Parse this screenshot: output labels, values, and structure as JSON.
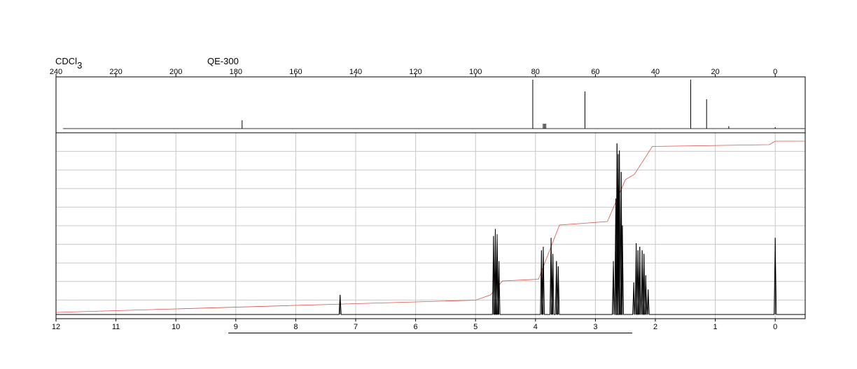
{
  "header": {
    "solvent_main": "CDCl",
    "solvent_sub": "3",
    "instrument": "QE-300"
  },
  "chart_data": [
    {
      "type": "line",
      "name": "13C NMR spectrum",
      "xlim": [
        240,
        -10
      ],
      "x_reversed": true,
      "ticks": [
        240,
        220,
        200,
        180,
        160,
        140,
        120,
        100,
        80,
        60,
        40,
        20,
        0
      ],
      "tick_labels": [
        "240",
        "220",
        "200",
        "180",
        "160",
        "140",
        "120",
        "100",
        "80",
        "60",
        "40",
        "20",
        "0"
      ],
      "grid": false,
      "peaks": [
        {
          "x": 177.9,
          "height": 0.17
        },
        {
          "x": 80.9,
          "height": 1.0
        },
        {
          "x": 77.4,
          "height": 0.1
        },
        {
          "x": 77.0,
          "height": 0.1
        },
        {
          "x": 76.6,
          "height": 0.1
        },
        {
          "x": 63.5,
          "height": 0.76
        },
        {
          "x": 28.2,
          "height": 1.0
        },
        {
          "x": 22.9,
          "height": 0.6
        },
        {
          "x": 15.5,
          "height": 0.05
        },
        {
          "x": 0.0,
          "height": 0.03
        }
      ]
    },
    {
      "type": "line",
      "name": "1H NMR spectrum",
      "xlim": [
        12,
        -0.5
      ],
      "x_reversed": true,
      "ticks": [
        12,
        11,
        10,
        9,
        8,
        7,
        6,
        5,
        4,
        3,
        2,
        1,
        0
      ],
      "tick_labels": [
        "12",
        "11",
        "10",
        "9",
        "8",
        "7",
        "6",
        "5",
        "4",
        "3",
        "2",
        "1",
        "0"
      ],
      "grid": true,
      "peaks": [
        {
          "x": 7.26,
          "height": 0.11
        },
        {
          "x": 4.7,
          "height": 0.44
        },
        {
          "x": 4.67,
          "height": 0.48
        },
        {
          "x": 4.64,
          "height": 0.45
        },
        {
          "x": 4.61,
          "height": 0.3
        },
        {
          "x": 3.9,
          "height": 0.36
        },
        {
          "x": 3.87,
          "height": 0.38
        },
        {
          "x": 3.74,
          "height": 0.43
        },
        {
          "x": 3.71,
          "height": 0.34
        },
        {
          "x": 3.65,
          "height": 0.3
        },
        {
          "x": 3.62,
          "height": 0.27
        },
        {
          "x": 2.7,
          "height": 0.3
        },
        {
          "x": 2.66,
          "height": 0.65
        },
        {
          "x": 2.64,
          "height": 0.96
        },
        {
          "x": 2.62,
          "height": 0.9
        },
        {
          "x": 2.6,
          "height": 0.92
        },
        {
          "x": 2.57,
          "height": 0.8
        },
        {
          "x": 2.55,
          "height": 0.5
        },
        {
          "x": 2.36,
          "height": 0.18
        },
        {
          "x": 2.32,
          "height": 0.4
        },
        {
          "x": 2.29,
          "height": 0.36
        },
        {
          "x": 2.26,
          "height": 0.38
        },
        {
          "x": 2.22,
          "height": 0.36
        },
        {
          "x": 2.19,
          "height": 0.34
        },
        {
          "x": 2.16,
          "height": 0.22
        },
        {
          "x": 2.12,
          "height": 0.14
        },
        {
          "x": 0.0,
          "height": 0.43
        }
      ],
      "integral": [
        {
          "x": 12.0,
          "y": 0.0
        },
        {
          "x": 5.0,
          "y": 0.07
        },
        {
          "x": 4.75,
          "y": 0.1
        },
        {
          "x": 4.55,
          "y": 0.18
        },
        {
          "x": 3.95,
          "y": 0.19
        },
        {
          "x": 3.6,
          "y": 0.5
        },
        {
          "x": 2.8,
          "y": 0.52
        },
        {
          "x": 2.5,
          "y": 0.76
        },
        {
          "x": 2.35,
          "y": 0.79
        },
        {
          "x": 2.05,
          "y": 0.95
        },
        {
          "x": 0.1,
          "y": 0.96
        },
        {
          "x": 0.0,
          "y": 0.98
        },
        {
          "x": -0.5,
          "y": 0.98
        }
      ]
    }
  ]
}
